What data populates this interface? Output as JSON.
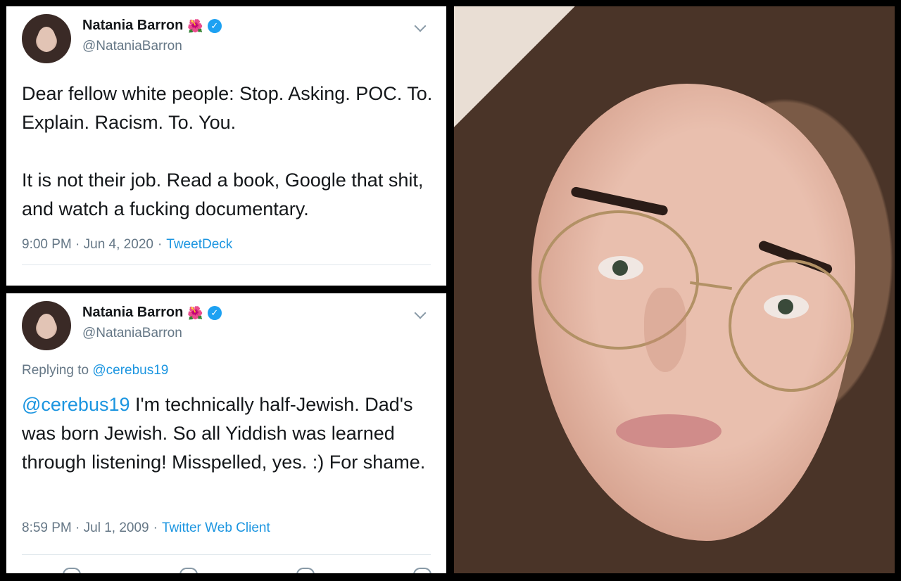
{
  "tweets": [
    {
      "author": {
        "name": "Natania Barron",
        "handle": "@NataniaBarron",
        "emoji": "🌺"
      },
      "body": "Dear fellow white people: Stop. Asking. POC. To. Explain. Racism. To. You.\n\nIt is not their job. Read a book, Google that shit, and watch a fucking documentary.",
      "timestamp": "9:00 PM · Jun 4, 2020",
      "separator": "·",
      "source": "TweetDeck"
    },
    {
      "author": {
        "name": "Natania Barron",
        "handle": "@NataniaBarron",
        "emoji": "🌺"
      },
      "replying_label": "Replying to",
      "replying_to": "@cerebus19",
      "mention": "@cerebus19",
      "body": " I'm technically half-Jewish. Dad's was born Jewish.  So all Yiddish was learned through listening! Misspelled, yes. :) For shame.",
      "timestamp": "8:59 PM · Jul 1, 2009",
      "separator": "·",
      "source": "Twitter Web Client"
    }
  ],
  "icons": {
    "verified": "verified-badge-icon",
    "chevron": "chevron-down-icon"
  },
  "colors": {
    "link": "#1b95e0",
    "verified": "#1da1f2",
    "muted": "#657786",
    "text": "#14171a"
  }
}
